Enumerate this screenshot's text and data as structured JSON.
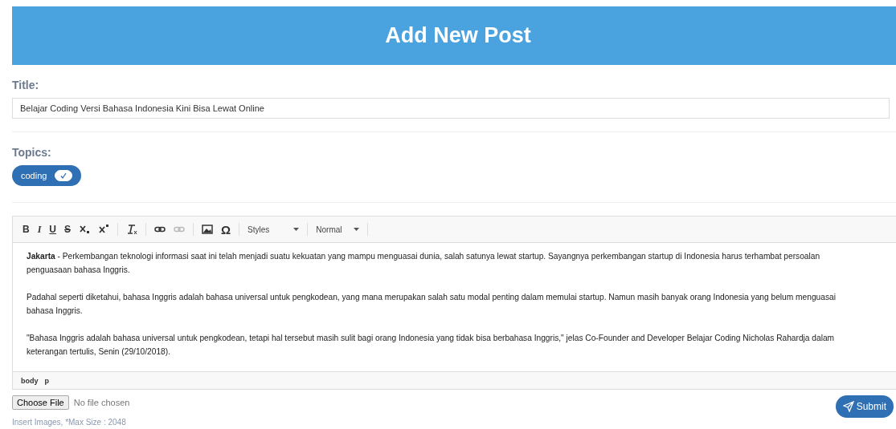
{
  "header": {
    "title": "Add New Post"
  },
  "title_field": {
    "label": "Title:",
    "value": "Belajar Coding Versi Bahasa Indonesia Kini Bisa Lewat Online"
  },
  "topics": {
    "label": "Topics:",
    "tags": [
      {
        "label": "coding",
        "checked": true
      }
    ]
  },
  "editor": {
    "format_buttons": [
      {
        "label": "B",
        "kind": "bold"
      },
      {
        "label": "I",
        "kind": "italic"
      },
      {
        "label": "U",
        "kind": "underline"
      },
      {
        "label": "S",
        "kind": "strike"
      }
    ],
    "special_char": "Ω",
    "link_buttons": [
      {
        "disabled": false
      },
      {
        "disabled": true
      }
    ],
    "dropdowns": [
      {
        "label": "Styles"
      },
      {
        "label": "Normal"
      }
    ],
    "paragraphs": [
      "**Jakarta** - Perkembangan teknologi informasi saat ini telah menjadi suatu kekuatan yang mampu menguasai dunia, salah satunya lewat startup. Sayangnya perkembangan startup di Indonesia harus terhambat persoalan penguasaan bahasa Inggris.",
      "Padahal seperti diketahui, bahasa Inggris adalah bahasa universal untuk pengkodean, yang mana merupakan salah satu modal penting dalam memulai startup. Namun masih banyak orang Indonesia yang belum menguasai bahasa Inggris.",
      "\"Bahasa Inggris adalah bahasa universal untuk pengkodean, tetapi hal tersebut masih sulit bagi orang Indonesia yang tidak bisa berbahasa Inggris,\" jelas Co-Founder and Developer Belajar Coding Nicholas Rahardja dalam keterangan tertulis, Senin (29/10/2018)."
    ],
    "path": [
      "body",
      "p"
    ]
  },
  "file_input": {
    "button": "Choose File",
    "status": "No file chosen",
    "hint": "Insert Images, *Max Size : 2048"
  },
  "submit": {
    "label": "Submit"
  }
}
